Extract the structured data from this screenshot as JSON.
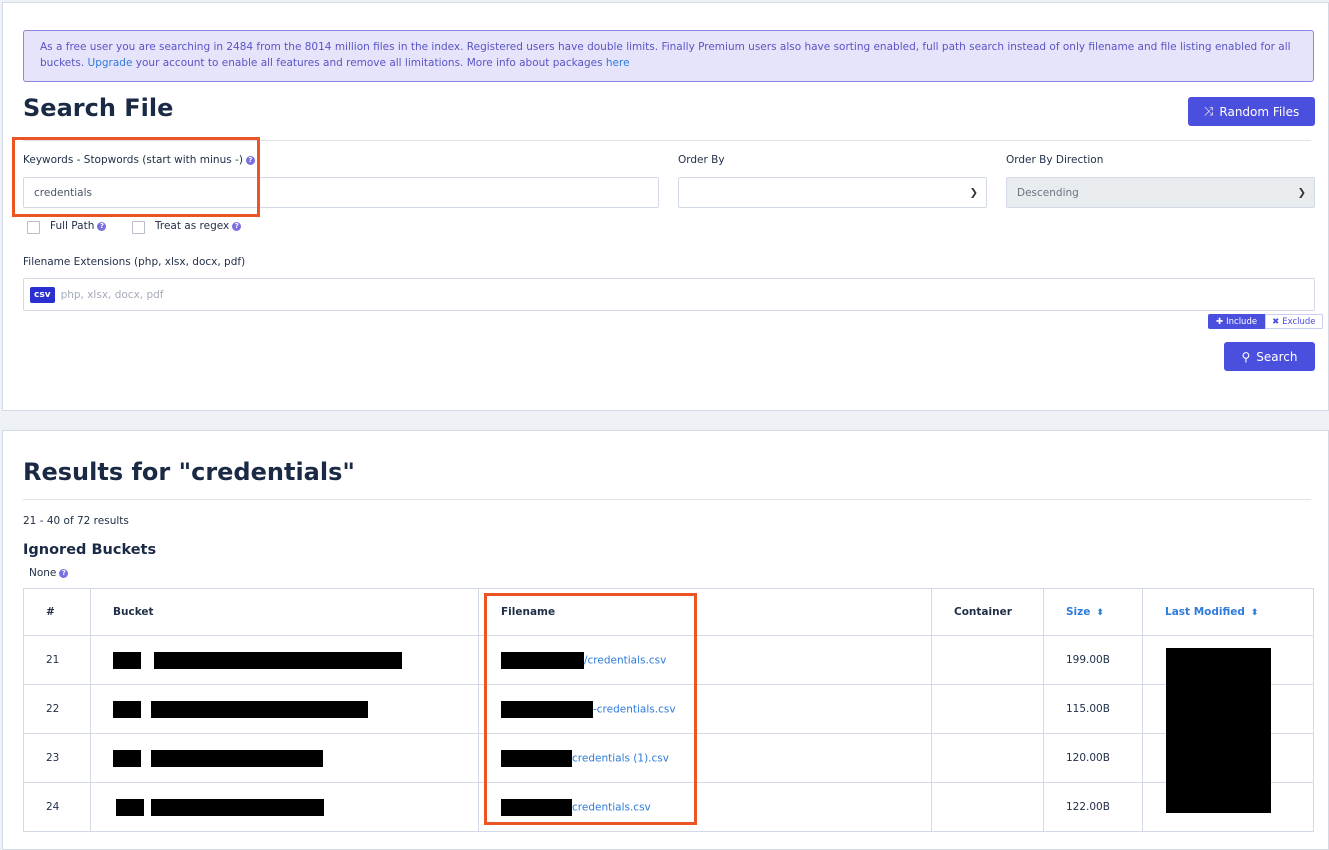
{
  "notice": {
    "text": "As a free user you are searching in 2484 from the 8014 million files in the index. Registered users have double limits. Finally Premium users also have sorting enabled, full path search instead of only filename and file listing enabled for all buckets. ",
    "upgrade_link": "Upgrade",
    "text2": " your account to enable all features and remove all limitations. More info about packages ",
    "here_link": "here"
  },
  "search": {
    "title": "Search File",
    "random_button": "Random Files",
    "random_icon": "shuffle-icon",
    "keywords_label": "Keywords - Stopwords (start with minus -)",
    "keywords_value": "credentials",
    "order_by_label": "Order By",
    "order_by_value": "",
    "order_dir_label": "Order By Direction",
    "order_dir_value": "Descending",
    "full_path_label": "Full Path",
    "regex_label": "Treat as regex",
    "ext_label": "Filename Extensions (php, xlsx, docx, pdf)",
    "ext_tag": "csv",
    "ext_placeholder": "php, xlsx, docx, pdf",
    "include_label": "Include",
    "exclude_label": "Exclude",
    "search_button": "Search"
  },
  "results": {
    "title": "Results for \"credentials\"",
    "count_text": "21 - 40 of 72 results",
    "ignored_title": "Ignored Buckets",
    "ignored_value": "None",
    "columns": [
      "#",
      "Bucket",
      "Filename",
      "Container",
      "Size",
      "Last Modified"
    ],
    "rows": [
      {
        "num": "21",
        "filename": "/credentials.csv",
        "size": "199.00B"
      },
      {
        "num": "22",
        "filename": "-credentials.csv",
        "size": "115.00B"
      },
      {
        "num": "23",
        "filename": "credentials (1).csv",
        "size": "120.00B"
      },
      {
        "num": "24",
        "filename": "credentials.csv",
        "size": "122.00B"
      }
    ]
  },
  "colors": {
    "accent": "#4b4fdd",
    "link": "#2f7bd9",
    "highlight": "#eb5423",
    "notice_bg": "#e6e4fb"
  }
}
